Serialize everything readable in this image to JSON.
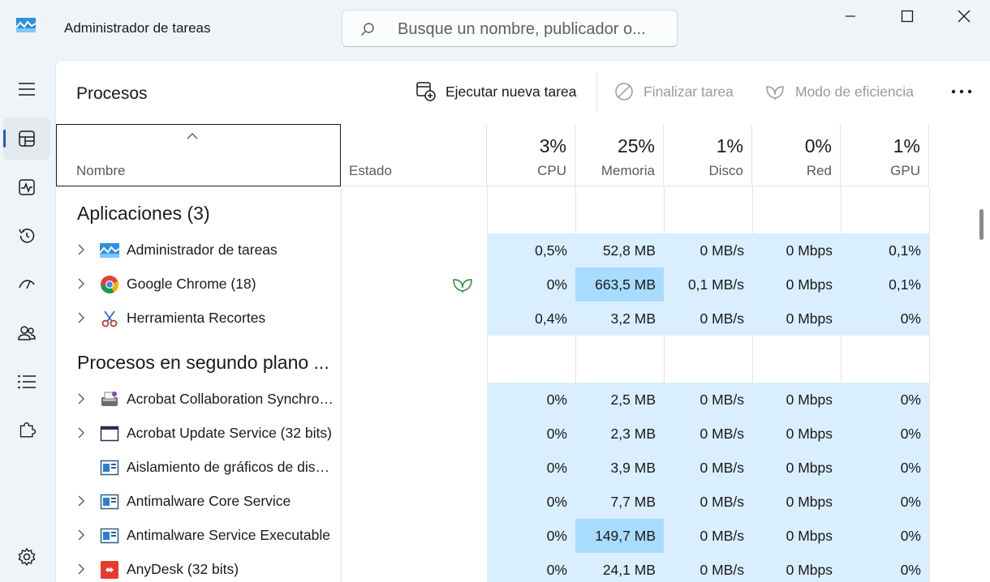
{
  "window": {
    "title": "Administrador de tareas",
    "search_placeholder": "Busque un nombre, publicador o..."
  },
  "toolbar": {
    "page_title": "Procesos",
    "run_task": "Ejecutar nueva tarea",
    "end_task": "Finalizar tarea",
    "efficiency_mode": "Modo de eficiencia"
  },
  "columns": {
    "name": "Nombre",
    "status": "Estado",
    "cpu": {
      "pct": "3%",
      "label": "CPU"
    },
    "memory": {
      "pct": "25%",
      "label": "Memoria"
    },
    "disk": {
      "pct": "1%",
      "label": "Disco"
    },
    "network": {
      "pct": "0%",
      "label": "Red"
    },
    "gpu": {
      "pct": "1%",
      "label": "GPU"
    }
  },
  "sections": {
    "apps": "Aplicaciones (3)",
    "background": "Procesos en segundo plano ..."
  },
  "apps": [
    {
      "name": "Administrador de tareas",
      "cpu": "0,5%",
      "memory": "52,8 MB",
      "disk": "0 MB/s",
      "network": "0 Mbps",
      "gpu": "0,1%"
    },
    {
      "name": "Google Chrome (18)",
      "cpu": "0%",
      "memory": "663,5 MB",
      "disk": "0,1 MB/s",
      "network": "0 Mbps",
      "gpu": "0,1%"
    },
    {
      "name": "Herramienta Recortes",
      "cpu": "0,4%",
      "memory": "3,2 MB",
      "disk": "0 MB/s",
      "network": "0 Mbps",
      "gpu": "0%"
    }
  ],
  "background": [
    {
      "name": "Acrobat Collaboration Synchronizer",
      "cpu": "0%",
      "memory": "2,5 MB",
      "disk": "0 MB/s",
      "network": "0 Mbps",
      "gpu": "0%"
    },
    {
      "name": "Acrobat Update Service (32 bits)",
      "cpu": "0%",
      "memory": "2,3 MB",
      "disk": "0 MB/s",
      "network": "0 Mbps",
      "gpu": "0%"
    },
    {
      "name": "Aislamiento de gráficos de dispositivo",
      "cpu": "0%",
      "memory": "3,9 MB",
      "disk": "0 MB/s",
      "network": "0 Mbps",
      "gpu": "0%"
    },
    {
      "name": "Antimalware Core Service",
      "cpu": "0%",
      "memory": "7,7 MB",
      "disk": "0 MB/s",
      "network": "0 Mbps",
      "gpu": "0%"
    },
    {
      "name": "Antimalware Service Executable",
      "cpu": "0%",
      "memory": "149,7 MB",
      "disk": "0 MB/s",
      "network": "0 Mbps",
      "gpu": "0%"
    },
    {
      "name": "AnyDesk (32 bits)",
      "cpu": "0%",
      "memory": "24,1 MB",
      "disk": "0 MB/s",
      "network": "0 Mbps",
      "gpu": "0%"
    }
  ],
  "colors": {
    "heat_low": "#d9efff",
    "heat_high": "#a8dcff",
    "accent": "#1f5fbf"
  },
  "icons": {
    "app": "task-manager-icon",
    "search": "search-icon",
    "minimize": "minimize-icon",
    "maximize": "maximize-icon",
    "close": "close-icon"
  }
}
